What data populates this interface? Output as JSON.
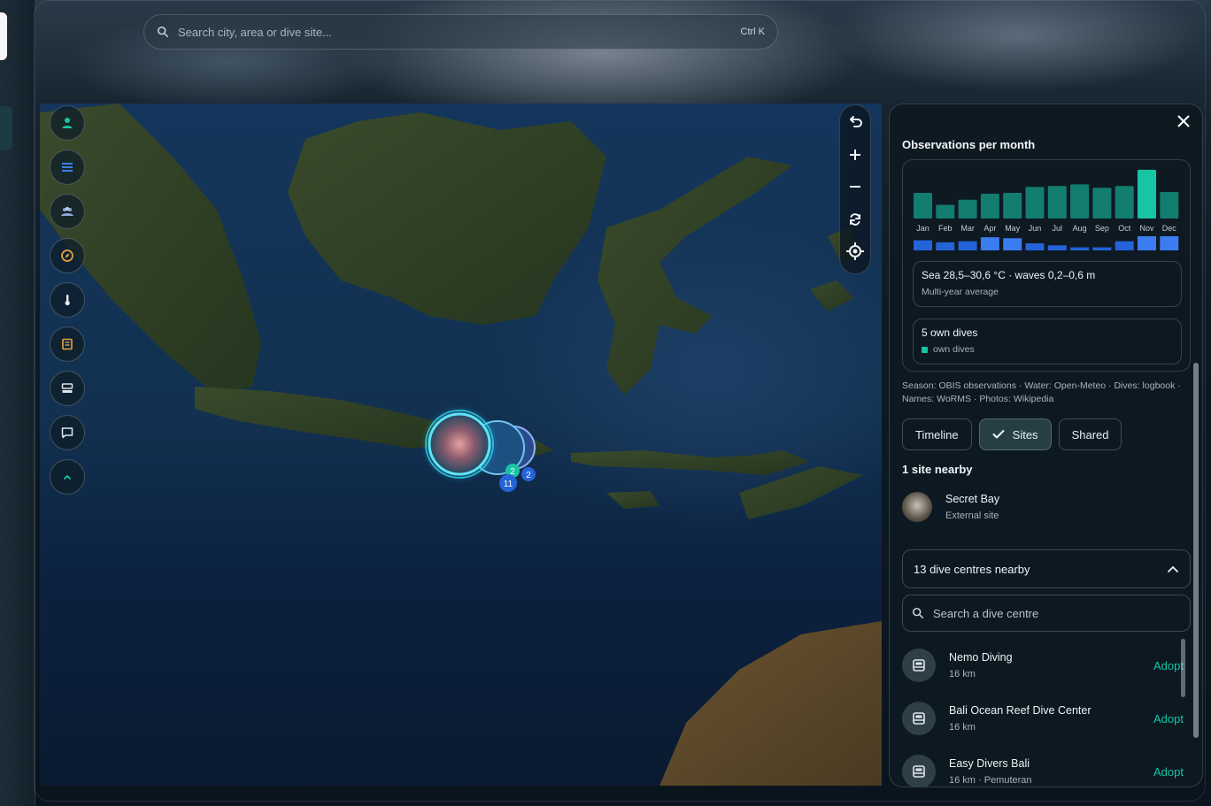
{
  "search": {
    "placeholder": "Search city, area or dive site...",
    "shortcut": "Ctrl K"
  },
  "rail": {
    "icons": [
      "user-icon",
      "list-icon",
      "group-icon",
      "compass-icon",
      "thermometer-icon",
      "logbook-icon",
      "equipment-icon",
      "chat-icon",
      "chevron-up-icon"
    ],
    "accent": "#17c4a4"
  },
  "map_controls": [
    "undo-icon",
    "zoom-in-icon",
    "zoom-out-icon",
    "rotate-icon",
    "locate-icon"
  ],
  "cluster": {
    "badges": [
      "2",
      "11",
      "2"
    ]
  },
  "panel": {
    "observations_title": "Observations per month",
    "months": [
      "Jan",
      "Feb",
      "Mar",
      "Apr",
      "May",
      "Jun",
      "Jul",
      "Aug",
      "Sep",
      "Oct",
      "Nov",
      "Dec"
    ],
    "sea_line": "Sea 28,5–30,6 °C · waves 0,2–0,6 m",
    "sea_sub": "Multi-year average",
    "dives_line": "5 own dives",
    "dives_legend": "own dives",
    "sources_line1": "Season: OBIS observations · Water: Open-Meteo · Dives: logbook ·",
    "sources_line2": "Names: WoRMS · Photos: Wikipedia",
    "tabs": [
      {
        "label": "Timeline"
      },
      {
        "label": "Sites"
      },
      {
        "label": "Shared"
      }
    ],
    "nearby_heading": "1 site nearby",
    "site": {
      "name": "Secret Bay",
      "type": "External site"
    },
    "centres_heading": "13 dive centres nearby",
    "centre_search_placeholder": "Search a dive centre",
    "centres": [
      {
        "name": "Nemo Diving",
        "detail": "16 km",
        "action": "Adopt"
      },
      {
        "name": "Bali Ocean Reef Dive Center",
        "detail": "16 km",
        "action": "Adopt"
      },
      {
        "name": "Easy Divers Bali",
        "detail": "16 km · Pemuteran",
        "action": "Adopt"
      }
    ]
  },
  "chart_data": {
    "type": "bar",
    "title": "Observations per month",
    "categories": [
      "Jan",
      "Feb",
      "Mar",
      "Apr",
      "May",
      "Jun",
      "Jul",
      "Aug",
      "Sep",
      "Oct",
      "Nov",
      "Dec"
    ],
    "series": [
      {
        "values": [
          30,
          16,
          22,
          29,
          30,
          37,
          38,
          40,
          36,
          38,
          57,
          31
        ],
        "color": "#137d70",
        "highlight_color": "#17c4a4",
        "highlight_index": 10
      },
      {
        "values": [
          10,
          8,
          9,
          13,
          12,
          7,
          5,
          3,
          3,
          9,
          14,
          14
        ],
        "color": "#2563d8",
        "highlight_color": "#3b7cf0"
      }
    ],
    "ylim": [
      0,
      60
    ],
    "grid": false,
    "legend": "none"
  }
}
